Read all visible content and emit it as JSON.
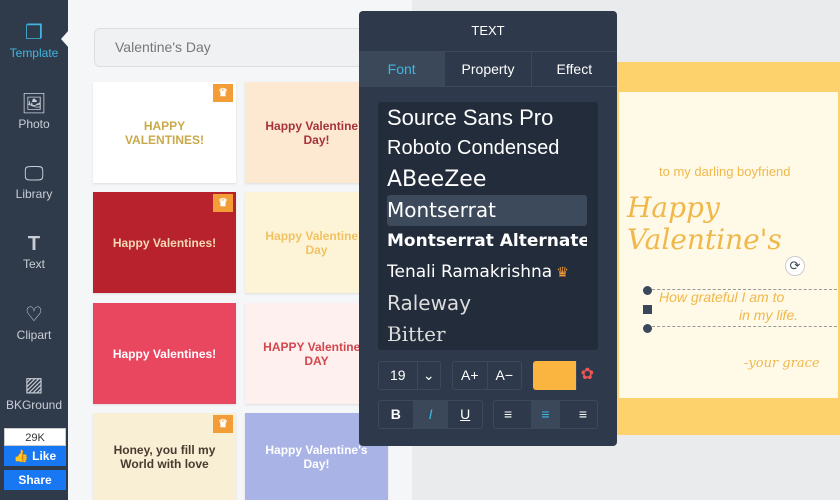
{
  "sidebar": {
    "items": [
      {
        "label": "Template",
        "icon": "template-icon",
        "glyph": "❐"
      },
      {
        "label": "Photo",
        "icon": "photo-icon",
        "glyph": "🖼"
      },
      {
        "label": "Library",
        "icon": "monitor-icon",
        "glyph": "🖵"
      },
      {
        "label": "Text",
        "icon": "text-icon",
        "glyph": "T"
      },
      {
        "label": "Clipart",
        "icon": "heart-icon",
        "glyph": "♡"
      },
      {
        "label": "BKGround",
        "icon": "background-icon",
        "glyph": "▨"
      }
    ],
    "facebook": {
      "count": "29K",
      "like": "Like",
      "share": "Share"
    }
  },
  "panel": {
    "category": "Valentine's Day",
    "templates": [
      {
        "text": "HAPPY VALENTINES!",
        "bg": "#ffffff",
        "fg": "#c9a94a",
        "premium": true
      },
      {
        "text": "Happy Valentine's Day!",
        "bg": "#fde9d2",
        "fg": "#a6333a",
        "premium": false
      },
      {
        "text": "Happy Valentines!",
        "bg": "#b8222c",
        "fg": "#f5d9b5",
        "premium": true
      },
      {
        "text": "Happy Valentine's Day",
        "bg": "#fdf4d8",
        "fg": "#f2c262",
        "premium": false
      },
      {
        "text": "Happy Valentines!",
        "bg": "#e94660",
        "fg": "#ffffff",
        "premium": false
      },
      {
        "text": "HAPPY Valentine's DAY",
        "bg": "#fdf0ee",
        "fg": "#d3474e",
        "premium": false
      },
      {
        "text": "Honey, you fill my World with love",
        "bg": "#f8efd4",
        "fg": "#4a3a30",
        "premium": true
      },
      {
        "text": "Happy Valentine's Day!",
        "bg": "#a9b3e6",
        "fg": "#ffffff",
        "premium": false
      }
    ]
  },
  "popup": {
    "title": "TEXT",
    "tabs": [
      "Font",
      "Property",
      "Effect"
    ],
    "fonts": [
      "Source Sans Pro",
      "Roboto Condensed",
      "ABeeZee",
      "Montserrat",
      "Montserrat Alternates",
      "Tenali Ramakrishna",
      "Raleway",
      "Bitter"
    ],
    "selected_font": "Montserrat",
    "font_size": "19",
    "increase": "A+",
    "decrease": "A−",
    "color": "#f9b53f",
    "format": [
      "B",
      "I",
      "U"
    ],
    "align": [
      "≡",
      "≡",
      "≡"
    ]
  },
  "canvas": {
    "line1": "to my darling boyfriend",
    "title": "Happy Valentine's",
    "body1": "How grateful I am to",
    "body2": "in my life.",
    "signature": "-your grace"
  }
}
